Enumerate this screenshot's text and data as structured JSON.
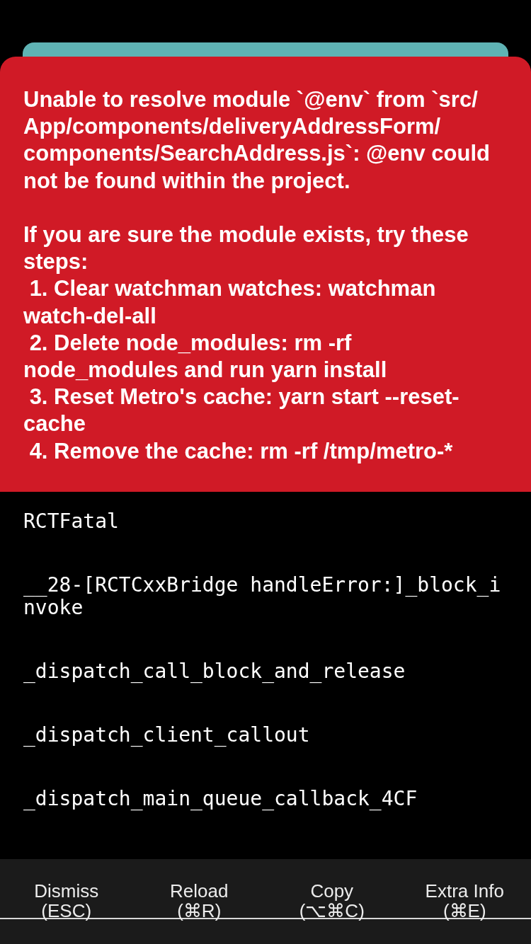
{
  "error_message": "Unable to resolve module `@env` from `src/App/components/deliveryAddressForm/components/SearchAddress.js`: @env could not be found within the project.\n\nIf you are sure the module exists, try these steps:\n 1. Clear watchman watches: watchman watch-del-all\n 2. Delete node_modules: rm -rf node_modules and run yarn install\n 3. Reset Metro's cache: yarn start --reset-cache\n 4. Remove the cache: rm -rf /tmp/metro-*",
  "stack_trace": [
    "RCTFatal",
    "__28-[RCTCxxBridge handleError:]_block_invoke",
    "_dispatch_call_block_and_release",
    "_dispatch_client_callout",
    "_dispatch_main_queue_callback_4CF"
  ],
  "actions": [
    {
      "label": "Dismiss",
      "shortcut": "(ESC)"
    },
    {
      "label": "Reload",
      "shortcut": "(⌘R)"
    },
    {
      "label": "Copy",
      "shortcut": "(⌥⌘C)"
    },
    {
      "label": "Extra Info",
      "shortcut": "(⌘E)"
    }
  ]
}
